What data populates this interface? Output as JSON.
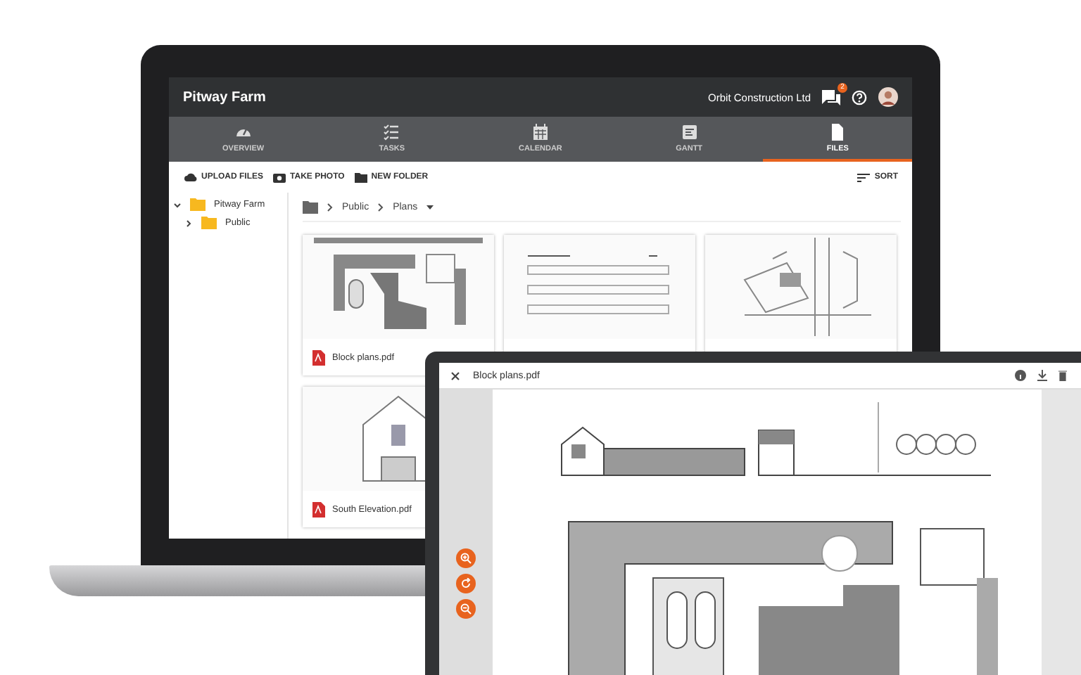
{
  "app": {
    "project": "Pitway Farm",
    "company": "Orbit Construction Ltd",
    "notification_count": "2"
  },
  "tabs": [
    {
      "label": "OVERVIEW",
      "selected": false
    },
    {
      "label": "TASKS",
      "selected": false
    },
    {
      "label": "CALENDAR",
      "selected": false
    },
    {
      "label": "GANTT",
      "selected": false
    },
    {
      "label": "FILES",
      "selected": true
    }
  ],
  "toolbar": [
    {
      "label": "UPLOAD FILES"
    },
    {
      "label": "TAKE PHOTO"
    },
    {
      "label": "NEW FOLDER"
    }
  ],
  "sort": {
    "label": "SORT"
  },
  "tree": [
    {
      "label": "Pitway Farm",
      "expanded": true,
      "children": [
        {
          "label": "Public",
          "expanded": false
        }
      ]
    }
  ],
  "breadcrumb": [
    {
      "label": "Public",
      "dropdown": false
    },
    {
      "label": "Plans",
      "dropdown": true
    }
  ],
  "files": [
    {
      "name": "Block plans.pdf",
      "kind": "plan"
    },
    {
      "kind": "table"
    },
    {
      "kind": "map"
    },
    {
      "name": "South Elevation.pdf",
      "kind": "elevation"
    }
  ],
  "viewer": {
    "title": "Block plans.pdf"
  }
}
